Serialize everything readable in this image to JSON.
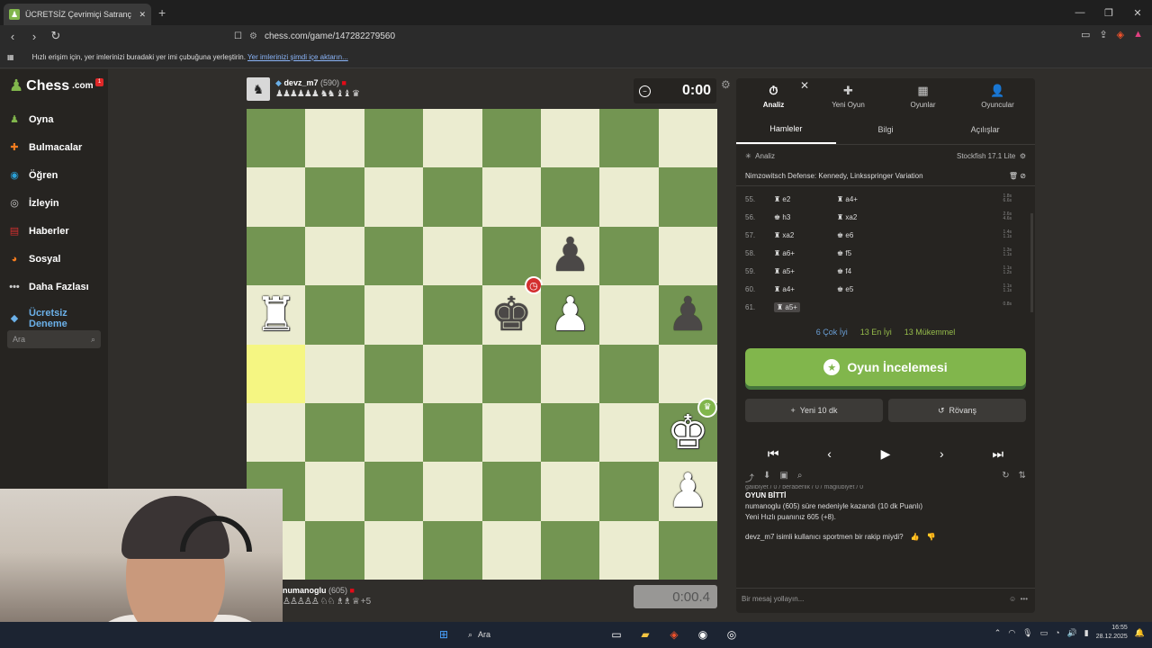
{
  "browser": {
    "tab_title": "ÜCRETSİZ Çevrimiçi Satranç Oyn",
    "url": "chess.com/game/147282279560",
    "bookmark_text": "Hızlı erişim için, yer imlerinizi buradaki yer imi çubuğuna yerleştirin.",
    "bookmark_link": "Yer imlerinizi şimdi içe aktarın..."
  },
  "sidebar": {
    "logo": "Chess",
    "logo_suffix": ".com",
    "notification_count": "1",
    "items": [
      {
        "label": "Oyna",
        "icon": "play-icon",
        "color": "#81b64c"
      },
      {
        "label": "Bulmacalar",
        "icon": "puzzle-icon",
        "color": "#f57c1f"
      },
      {
        "label": "Öğren",
        "icon": "learn-icon",
        "color": "#2a9fd6"
      },
      {
        "label": "İzleyin",
        "icon": "binoculars-icon",
        "color": "#cccccc"
      },
      {
        "label": "Haberler",
        "icon": "news-icon",
        "color": "#d32f2f"
      },
      {
        "label": "Sosyal",
        "icon": "social-icon",
        "color": "#f57c1f"
      },
      {
        "label": "Daha Fazlası",
        "icon": "more-icon",
        "color": "#cccccc"
      }
    ],
    "trial_label_1": "Ücretsiz",
    "trial_label_2": "Deneme",
    "search_placeholder": "Ara"
  },
  "top_player": {
    "name": "devz_m7",
    "rating": "(590)",
    "captured": "♟♟♟♟♟♟ ♞♞ ♝♝ ♛",
    "clock": "0:00"
  },
  "bottom_player": {
    "name": "numanoglu",
    "rating": "(605)",
    "captured": "♙♙♙♙♙ ♘♘ ♗♗ ♕",
    "advantage": "+5",
    "clock": "0:00.4"
  },
  "board": {
    "light": "#ebecd0",
    "dark": "#739552",
    "highlight": "#f5f682",
    "pieces": [
      {
        "sq": "f6",
        "glyph": "♟",
        "color": "b"
      },
      {
        "sq": "a5",
        "glyph": "♜",
        "color": "w"
      },
      {
        "sq": "e5",
        "glyph": "♚",
        "color": "b",
        "badge": "timeout"
      },
      {
        "sq": "f5",
        "glyph": "♟",
        "color": "w"
      },
      {
        "sq": "h5",
        "glyph": "♟",
        "color": "b"
      },
      {
        "sq": "h3",
        "glyph": "♚",
        "color": "w",
        "badge": "win"
      },
      {
        "sq": "h2",
        "glyph": "♟",
        "color": "w"
      }
    ],
    "highlight_squares": [
      "a4"
    ]
  },
  "panel": {
    "tabs": [
      {
        "label": "Analiz",
        "icon": "timer-icon",
        "active": true
      },
      {
        "label": "Yeni Oyun",
        "icon": "plus-icon",
        "active": false
      },
      {
        "label": "Oyunlar",
        "icon": "board-icon",
        "active": false
      },
      {
        "label": "Oyuncular",
        "icon": "players-icon",
        "active": false
      }
    ],
    "subtabs": [
      "Hamleler",
      "Bilgi",
      "Açılışlar"
    ],
    "analysis_label": "Analiz",
    "engine": "Stockfish 17.1 Lite",
    "opening": "Nimzowitsch Defense: Kennedy, Linksspringer Variation",
    "moves": [
      {
        "n": "55.",
        "w": "♜ e2",
        "b": "♜ a4+",
        "t1": "1.8s",
        "t2": "6.6s"
      },
      {
        "n": "56.",
        "w": "♚ h3",
        "b": "♜ xa2",
        "t1": "2.6s",
        "t2": "4.6s"
      },
      {
        "n": "57.",
        "w": "♜ xa2",
        "b": "♚ e6",
        "t1": "1.4s",
        "t2": "1.1s"
      },
      {
        "n": "58.",
        "w": "♜ a6+",
        "b": "♚ f5",
        "t1": "1.3s",
        "t2": "1.1s"
      },
      {
        "n": "59.",
        "w": "♜ a5+",
        "b": "♚ f4",
        "t1": "1.1s",
        "t2": "1.2s"
      },
      {
        "n": "60.",
        "w": "♜ a4+",
        "b": "♚ e5",
        "t1": "1.1s",
        "t2": "1.1s"
      },
      {
        "n": "61.",
        "w": "♜ a5+",
        "b": "",
        "t1": "0.8s",
        "t2": ""
      }
    ],
    "quality": {
      "q1": "6 Çok İyi",
      "q2": "13 En İyi",
      "q3": "13 Mükemmel"
    },
    "review_button": "Oyun İncelemesi",
    "new_game_button": "Yeni 10 dk",
    "rematch_button": "Rövanş",
    "log_muted": "galibiyet / 0 / beraberlik / 0 / mağlubiyet / 0",
    "game_over": "OYUN BİTTİ",
    "result_line": "numanoglu (605) süre nedeniyle kazandı (10 dk Puanlı)",
    "rating_line": "Yeni Hızlı puanınız 605 (+8).",
    "sportsman": "devz_m7 isimli kullanıcı sportmen bir rakip miydi?",
    "message_placeholder": "Bir mesaj yollayın..."
  },
  "taskbar": {
    "search": "Ara",
    "time": "16:55",
    "date": "28.12.2025"
  }
}
